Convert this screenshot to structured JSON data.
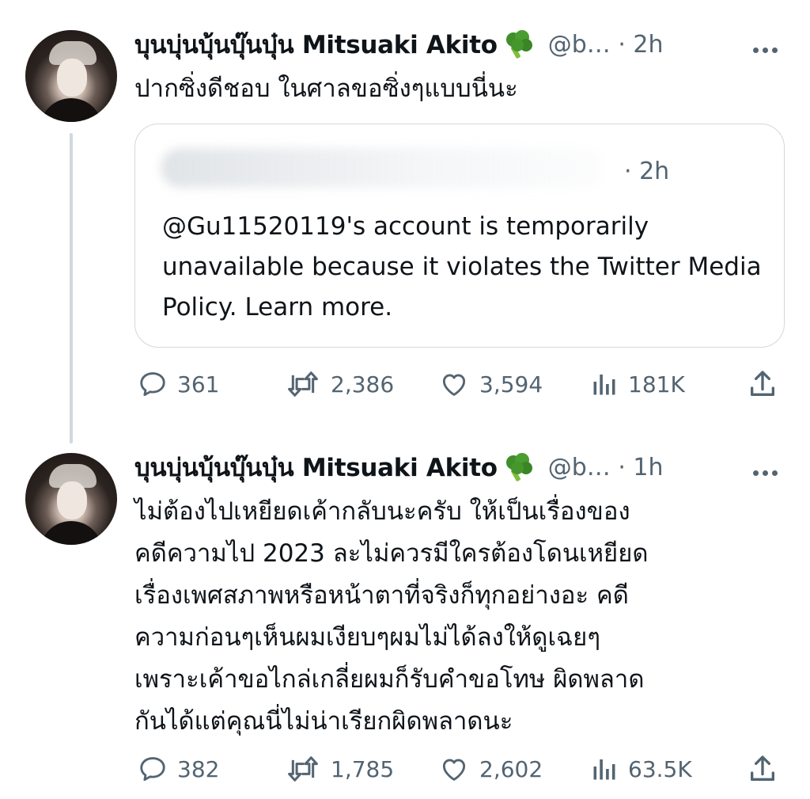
{
  "tweets": [
    {
      "display_name": "บุนบุ่นบุ้นบุ๊นบุ๋น Mitsuaki Akito",
      "emoji_icon": "broccoli-icon",
      "handle_time": "@b… · 2h",
      "text": "ปากซิ่งดีชอบ ในศาลขอซิ่งๆแบบนี่นะ",
      "quote": {
        "time": "· 2h",
        "text": "@Gu11520119's account is temporarily unavailable because it violates the Twitter Media Policy. Learn more."
      },
      "stats": {
        "replies": "361",
        "retweets": "2,386",
        "likes": "3,594",
        "views": "181K"
      }
    },
    {
      "display_name": "บุนบุ่นบุ้นบุ๊นบุ๋น Mitsuaki Akito",
      "emoji_icon": "broccoli-icon",
      "handle_time": "@b… · 1h",
      "text": "ไม่ต้องไปเหยียดเค้ากลับนะครับ ให้เป็นเรื่องของ\nคดีความไป 2023 ละไม่ควรมีใครต้องโดนเหยียด\nเรื่องเพศสภาพหรือหน้าตาที่จริงก็ทุกอย่างอะ คดี\nความก่อนๆเห็นผมเงียบๆผมไม่ได้ลงให้ดูเฉยๆ\nเพราะเค้าขอไกล่เกลี่ยผมก็รับคำขอโทษ ผิดพลาด\nกันได้แต่คุณนี่ไม่น่าเรียกผิดพลาดนะ",
      "stats": {
        "replies": "382",
        "retweets": "1,785",
        "likes": "2,602",
        "views": "63.5K"
      }
    }
  ],
  "colors": {
    "text": "#0f1419",
    "secondary": "#536471",
    "border": "#cfd9de",
    "broccoli": "#3f8f2a"
  }
}
